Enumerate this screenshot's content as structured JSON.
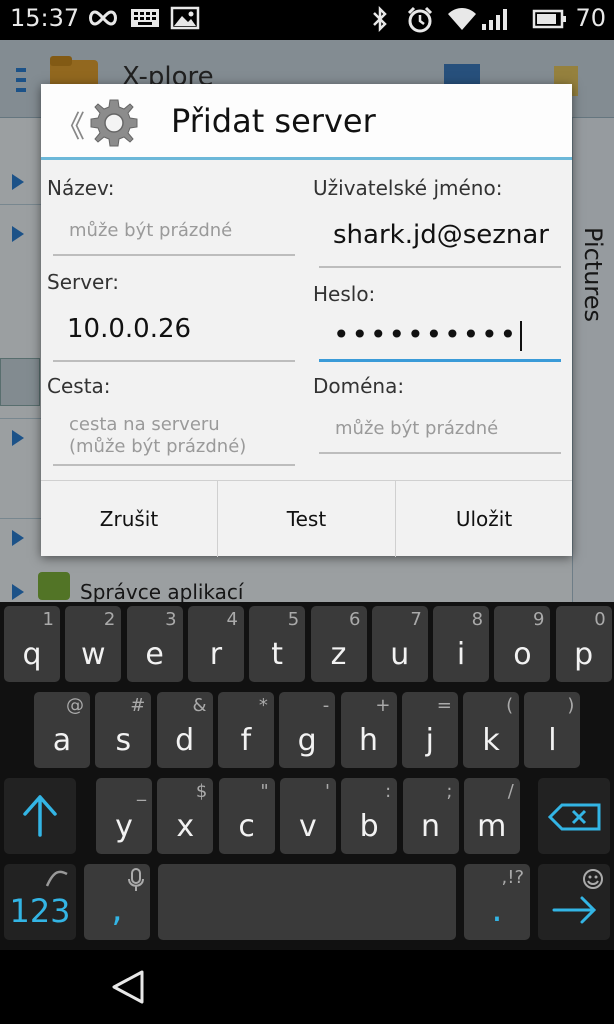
{
  "status": {
    "time": "15:37",
    "battery": "70"
  },
  "app": {
    "title": "X-plore",
    "right_panel_label": "Pictures",
    "bottom_item": "Správce aplikací"
  },
  "dialog": {
    "title": "Přidat server",
    "fields": {
      "name": {
        "label": "Název:",
        "placeholder": "může být prázdné",
        "value": ""
      },
      "username": {
        "label": "Uživatelské jméno:",
        "value": "shark.jd@seznar"
      },
      "server": {
        "label": "Server:",
        "value": "10.0.0.26"
      },
      "password": {
        "label": "Heslo:",
        "value": "••••••••••"
      },
      "path": {
        "label": "Cesta:",
        "placeholder": "cesta na serveru\n(může být prázdné)"
      },
      "domain": {
        "label": "Doména:",
        "placeholder": "může být prázdné"
      }
    },
    "buttons": {
      "cancel": "Zrušit",
      "test": "Test",
      "save": "Uložit"
    }
  },
  "keyboard": {
    "row1": [
      {
        "k": "q",
        "h": "1"
      },
      {
        "k": "w",
        "h": "2"
      },
      {
        "k": "e",
        "h": "3"
      },
      {
        "k": "r",
        "h": "4"
      },
      {
        "k": "t",
        "h": "5"
      },
      {
        "k": "z",
        "h": "6"
      },
      {
        "k": "u",
        "h": "7"
      },
      {
        "k": "i",
        "h": "8"
      },
      {
        "k": "o",
        "h": "9"
      },
      {
        "k": "p",
        "h": "0"
      }
    ],
    "row2": [
      {
        "k": "a",
        "h": "@"
      },
      {
        "k": "s",
        "h": "#"
      },
      {
        "k": "d",
        "h": "&"
      },
      {
        "k": "f",
        "h": "*"
      },
      {
        "k": "g",
        "h": "-"
      },
      {
        "k": "h",
        "h": "+"
      },
      {
        "k": "j",
        "h": "="
      },
      {
        "k": "k",
        "h": "("
      },
      {
        "k": "l",
        "h": ")"
      }
    ],
    "row3": [
      {
        "k": "y",
        "h": "_"
      },
      {
        "k": "x",
        "h": "$"
      },
      {
        "k": "c",
        "h": "\""
      },
      {
        "k": "v",
        "h": "'"
      },
      {
        "k": "b",
        "h": ":"
      },
      {
        "k": "n",
        "h": ";"
      },
      {
        "k": "m",
        "h": "/"
      }
    ],
    "numbers_key": "123",
    "comma_key": ",",
    "period_key": ".",
    "period_hint": ",!?",
    "accent_color": "#33b5e5"
  }
}
